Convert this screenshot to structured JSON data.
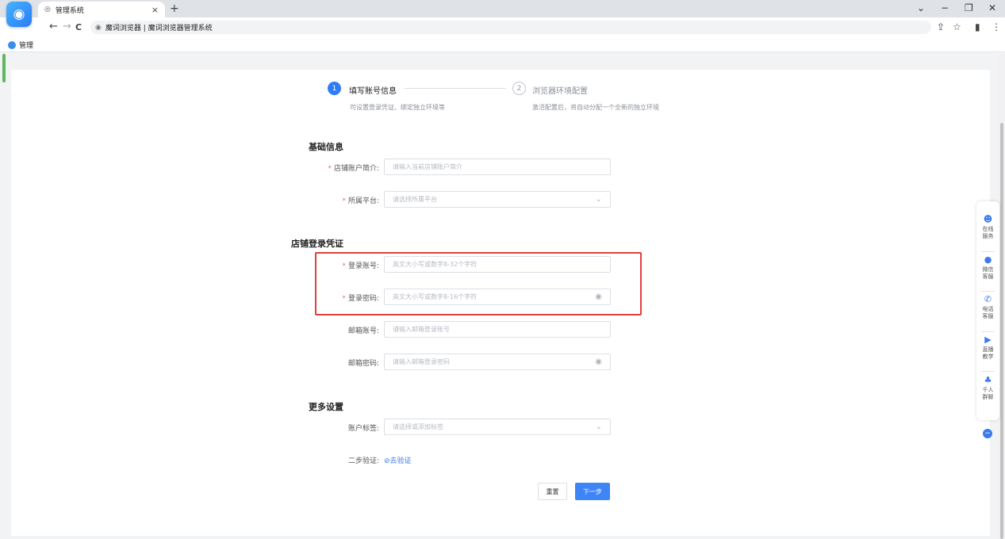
{
  "browser": {
    "tab_title": "管理系统",
    "new_tab": "+",
    "tab_close": "×",
    "address": "魔词浏览器 | 魔词浏览器管理系统",
    "bookmark": "管理",
    "nav": {
      "back": "←",
      "forward": "→",
      "reload": "C"
    },
    "window": {
      "chevron": "⌄",
      "minimize": "−",
      "restore": "❐",
      "close": "✕"
    },
    "toolbar_right": {
      "share": "⇪",
      "star": "☆",
      "sidebar": "▮",
      "menu": "⋮"
    }
  },
  "steps": [
    {
      "number": "1",
      "title": "填写账号信息",
      "desc": "可设置登录凭证、绑定独立环境等"
    },
    {
      "number": "2",
      "title": "浏览器环境配置",
      "desc": "激活配置后，将自动分配一个全新的独立环境"
    }
  ],
  "sections": {
    "basic": "基础信息",
    "login": "店铺登录凭证",
    "more": "更多设置"
  },
  "fields": {
    "shop_intro": {
      "label": "店铺账户简介:",
      "placeholder": "请输入当前店铺账户简介"
    },
    "platform": {
      "label": "所属平台:",
      "placeholder": "请选择所属平台"
    },
    "login_account": {
      "label": "登录账号:",
      "placeholder": "英文大小写或数字8-32个字符"
    },
    "login_password": {
      "label": "登录密码:",
      "placeholder": "英文大小写或数字8-16个字符"
    },
    "email_account": {
      "label": "邮箱账号:",
      "placeholder": "请输入邮箱登录账号"
    },
    "email_password": {
      "label": "邮箱密码:",
      "placeholder": "请输入邮箱登录密码"
    },
    "account_tags": {
      "label": "账户标签:",
      "placeholder": "请选择或添加标签"
    },
    "two_step": {
      "label": "二步验证:",
      "link": "⊘去验证"
    }
  },
  "required_mark": "*",
  "buttons": {
    "reset": "重置",
    "next": "下一步"
  },
  "service_bar": [
    {
      "icon": "☻",
      "label": "在线\n服务"
    },
    {
      "icon": "●",
      "label": "微信\n客服"
    },
    {
      "icon": "✆",
      "label": "电话\n客服"
    },
    {
      "icon": "▶",
      "label": "直播\n教学"
    },
    {
      "icon": "♣",
      "label": "千人\n群聊"
    }
  ],
  "collapse": "−",
  "icons": {
    "eye": "◉",
    "chevron": "⌄"
  },
  "colors": {
    "primary": "#2f7df6",
    "highlight": "#e0403b",
    "required": "#f56c6c"
  }
}
